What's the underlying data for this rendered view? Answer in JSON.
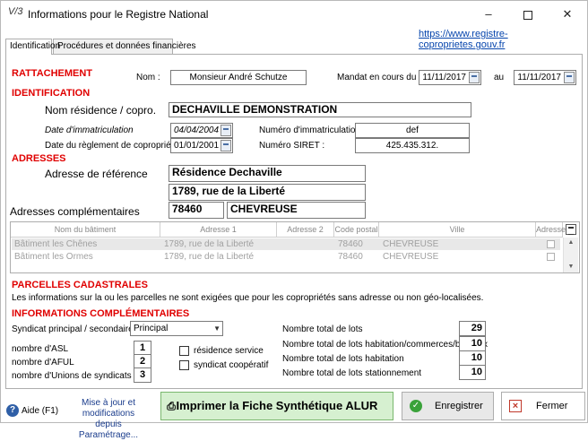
{
  "window": {
    "title": "Informations pour le Registre National",
    "app_icon": "V/3"
  },
  "tabs": [
    {
      "label": "Identification",
      "active": true
    },
    {
      "label": "Procédures et données financières",
      "active": false
    }
  ],
  "link_text": "https://www.registre-coproprietes.gouv.fr",
  "rattachement": {
    "header": "RATTACHEMENT",
    "nom_label": "Nom :",
    "nom_value": "Monsieur André Schutze",
    "mandat_label": "Mandat en cours du",
    "mandat_from": "11/11/2017",
    "au_label": "au",
    "mandat_to": "11/11/2017"
  },
  "identification": {
    "header": "IDENTIFICATION",
    "nom_residence_label": "Nom résidence / copro.",
    "nom_residence_value": "DECHAVILLE DEMONSTRATION",
    "date_immat_label": "Date d'immatriculation",
    "date_immat_value": "04/04/2004",
    "num_immat_label": "Numéro d'immatriculation :",
    "num_immat_value": "def",
    "date_reglement_label": "Date du règlement de copropriété",
    "date_reglement_value": "01/01/2001",
    "siret_label": "Numéro SIRET :",
    "siret_value": "425.435.312."
  },
  "adresses": {
    "header": "ADRESSES",
    "ref_label": "Adresse de référence",
    "ref_line1": "Résidence Dechaville",
    "ref_line2": "1789, rue de la Liberté",
    "comp_label": "Adresses complémentaires",
    "postal_code": "78460",
    "city": "CHEVREUSE",
    "table": {
      "columns": [
        "Nom du bâtiment",
        "Adresse 1",
        "Adresse 2",
        "Code postal",
        "Ville",
        "Adresse"
      ],
      "rows": [
        {
          "batiment": "Bâtiment les Chênes",
          "adresse1": "1789, rue de la Liberté",
          "adresse2": "",
          "cp": "78460",
          "ville": "CHEVREUSE"
        },
        {
          "batiment": "Bâtiment les Ormes",
          "adresse1": "1789, rue de la Liberté",
          "adresse2": "",
          "cp": "78460",
          "ville": "CHEVREUSE"
        }
      ]
    }
  },
  "parcelles": {
    "header": "PARCELLES CADASTRALES",
    "note": "Les informations sur la ou les parcelles ne sont exigées que pour les copropriétés sans adresse ou non géo-localisées."
  },
  "complementaires": {
    "header": "INFORMATIONS COMPLÉMENTAIRES",
    "syndicat_label": "Syndicat principal / secondaire*",
    "syndicat_value": "Principal",
    "asl_label": "nombre d'ASL",
    "asl_value": "1",
    "aful_label": "nombre d'AFUL",
    "aful_value": "2",
    "unions_label": "nombre d'Unions de syndicats",
    "unions_value": "3",
    "residence_service_label": "résidence service",
    "syndicat_coop_label": "syndicat coopératif",
    "total_lots_label": "Nombre total de lots",
    "total_lots_value": "29",
    "lots_hab_label": "Nombre total de lots habitation/commerces/bureaux",
    "lots_hab_value": "10",
    "lots_habitation_label": "Nombre total de lots habitation",
    "lots_habitation_value": "10",
    "lots_stat_label": "Nombre total de lots stationnement",
    "lots_stat_value": "10"
  },
  "footer": {
    "aide_label": "Aide (F1)",
    "update_note": "Mise à jour et modifications depuis Paramétrage...",
    "print_label": "Imprimer la Fiche Synthétique ALUR",
    "save_label": "Enregistrer",
    "close_label": "Fermer"
  },
  "colors": {
    "section_red": "#e00000",
    "link_blue": "#0645ad",
    "print_green": "#d6f0d0"
  }
}
